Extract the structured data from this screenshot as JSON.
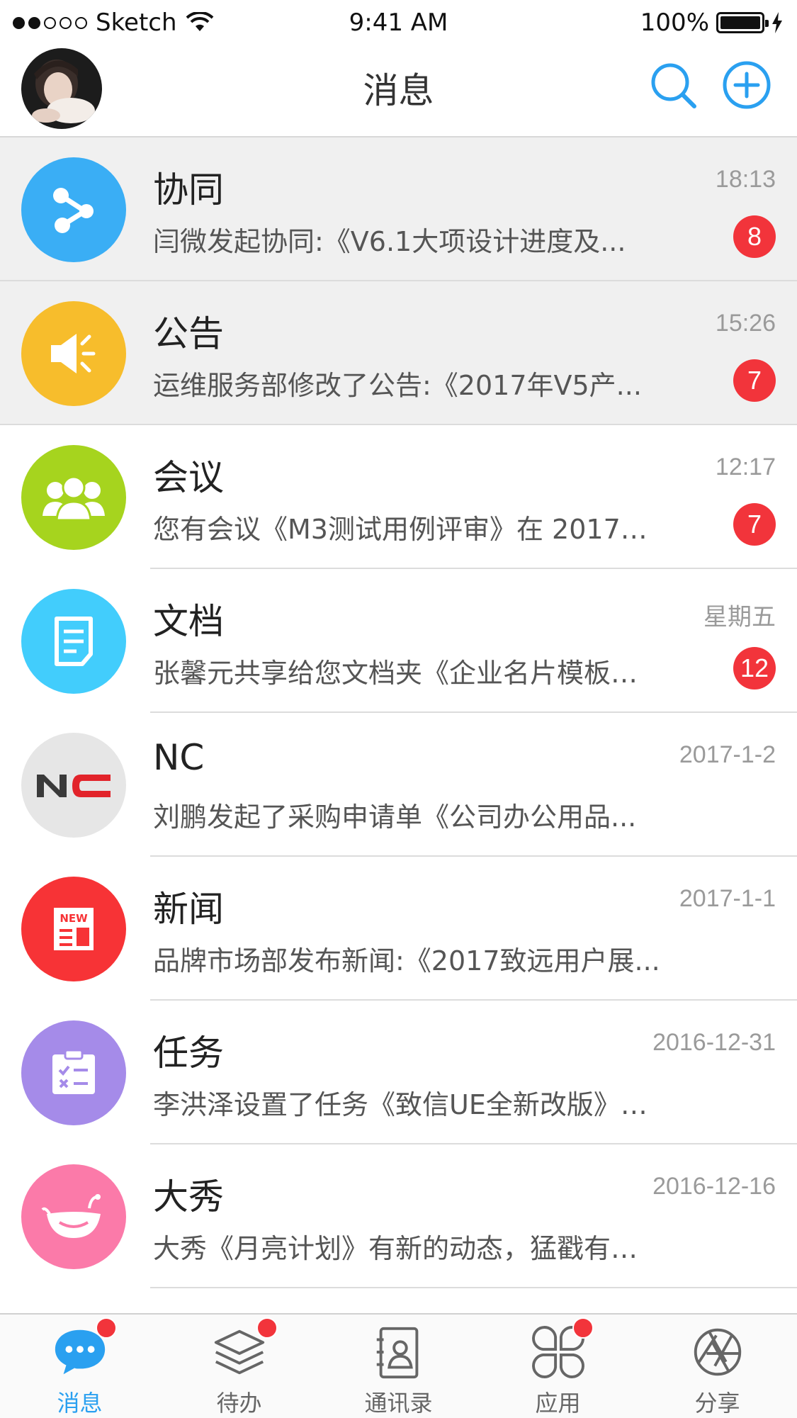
{
  "status_bar": {
    "carrier": "Sketch",
    "time": "9:41 AM",
    "battery": "100%"
  },
  "header": {
    "title": "消息",
    "search_icon": "search-icon",
    "add_icon": "plus-circle-icon"
  },
  "colors": {
    "accent": "#2aa0f0",
    "badge": "#f2343b"
  },
  "messages": [
    {
      "title": "协同",
      "time": "18:13",
      "preview": "闫微发起协同:《V6.1大项设计进度及...",
      "badge": "8",
      "icon": "share-icon",
      "color": "#3aaef5"
    },
    {
      "title": "公告",
      "time": "15:26",
      "preview": "运维服务部修改了公告:《2017年V5产...",
      "badge": "7",
      "icon": "megaphone-icon",
      "color": "#f7bd2c"
    },
    {
      "title": "会议",
      "time": "12:17",
      "preview": "您有会议《M3测试用例评审》在 2017…",
      "badge": "7",
      "icon": "group-icon",
      "color": "#a6d41e"
    },
    {
      "title": "文档",
      "time": "星期五",
      "preview": "张馨元共享给您文档夹《企业名片模板…",
      "badge": "12",
      "icon": "document-icon",
      "color": "#42cdfc"
    },
    {
      "title": "NC",
      "time": "2017-1-2",
      "preview": "刘鹏发起了采购申请单《公司办公用品...",
      "badge": "",
      "icon": "nc-logo-icon",
      "color": "#e6e6e6"
    },
    {
      "title": "新闻",
      "time": "2017-1-1",
      "preview": "品牌市场部发布新闻:《2017致远用户展...",
      "badge": "",
      "icon": "news-icon",
      "color": "#f73336"
    },
    {
      "title": "任务",
      "time": "2016-12-31",
      "preview": "李洪泽设置了任务《致信UE全新改版》…",
      "badge": "",
      "icon": "task-clipboard-icon",
      "color": "#a58be9"
    },
    {
      "title": "大秀",
      "time": "2016-12-16",
      "preview": "大秀《月亮计划》有新的动态，猛戳有…",
      "badge": "",
      "icon": "whale-icon",
      "color": "#fb7aa9"
    }
  ],
  "tabs": [
    {
      "label": "消息",
      "icon": "chat-bubble-icon",
      "active": true,
      "dot": true
    },
    {
      "label": "待办",
      "icon": "layers-icon",
      "active": false,
      "dot": true
    },
    {
      "label": "通讯录",
      "icon": "contacts-icon",
      "active": false,
      "dot": false
    },
    {
      "label": "应用",
      "icon": "apps-grid-icon",
      "active": false,
      "dot": true
    },
    {
      "label": "分享",
      "icon": "aperture-icon",
      "active": false,
      "dot": false
    }
  ]
}
